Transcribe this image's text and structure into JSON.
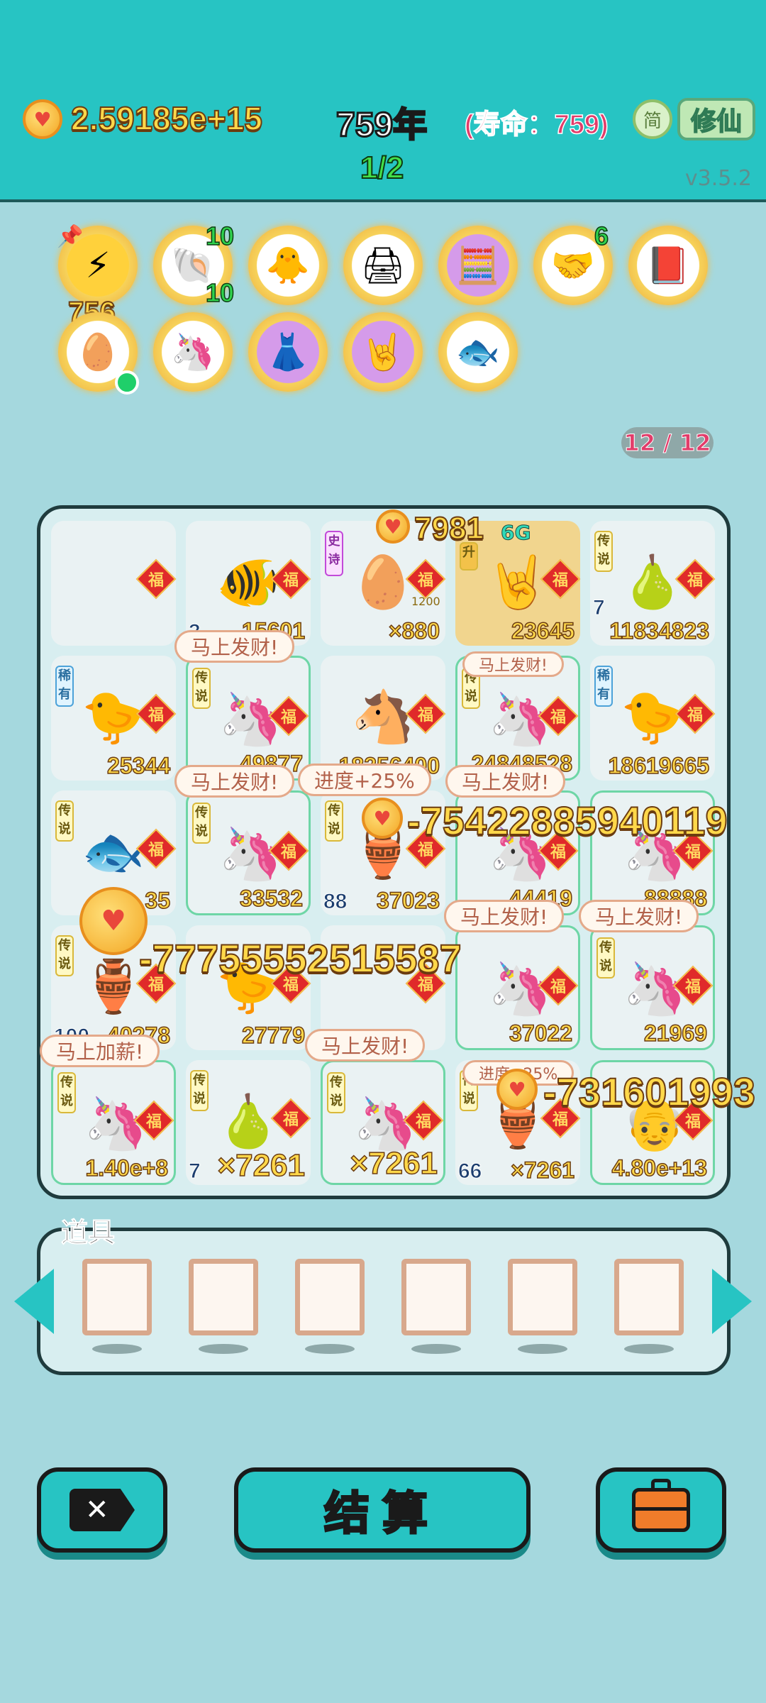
{
  "header": {
    "coins": "2.59185e+15",
    "year": "759年",
    "lifespan": "(寿命：759)",
    "jian_label": "简",
    "xiuxian_label": "修仙",
    "page": "1/2",
    "version": "v3.5.2"
  },
  "buffs": {
    "energy_count": "756",
    "shell_top": "10",
    "shell_bottom": "10",
    "handshake": "6"
  },
  "slot_count": "12 / 12",
  "board": {
    "cells": [
      {
        "num": "",
        "lv": ""
      },
      {
        "num": "15601",
        "lv": "3"
      },
      {
        "num": "×880",
        "lv": "",
        "tag": "史诗",
        "small": "1200"
      },
      {
        "num": "23645",
        "lv": "",
        "tag": "升"
      },
      {
        "num": "11834823",
        "lv": "7",
        "tag": "传说"
      },
      {
        "num": "25344",
        "lv": "",
        "tag": "稀有"
      },
      {
        "num": "49877",
        "lv": "",
        "tag": "传说"
      },
      {
        "num": "18256400",
        "lv": ""
      },
      {
        "num": "24848528",
        "lv": "",
        "tag": "传说"
      },
      {
        "num": "18619665",
        "lv": "",
        "tag": "稀有"
      },
      {
        "num": "35",
        "lv": "",
        "tag": "传说"
      },
      {
        "num": "33532",
        "lv": "",
        "tag": "传说"
      },
      {
        "num": "37023",
        "lv": "88",
        "tag": "传说"
      },
      {
        "num": "44419",
        "lv": ""
      },
      {
        "num": "88888",
        "lv": ""
      },
      {
        "num": "40278",
        "lv": "100",
        "tag": "传说"
      },
      {
        "num": "27779",
        "lv": ""
      },
      {
        "num": "",
        "lv": ""
      },
      {
        "num": "37022",
        "lv": ""
      },
      {
        "num": "21969",
        "lv": "",
        "tag": "传说"
      },
      {
        "num": "1.40e+8",
        "lv": "",
        "tag": "传说"
      },
      {
        "num": "×7261",
        "lv": "7",
        "tag": "传说"
      },
      {
        "num": "×7261",
        "lv": "",
        "tag": "传说"
      },
      {
        "num": "×7261",
        "lv": "66",
        "tag": "传说"
      },
      {
        "num": "4.80e+13",
        "lv": ""
      }
    ],
    "fu_label": "福",
    "bubbles": {
      "b1": "马上发财!",
      "b2": "马上发财!",
      "b3": "马上发财!",
      "b4": "进度+25%",
      "b5": "马上发财!",
      "b6": "马上发财!",
      "b7": "马上发财!",
      "b8": "马上加薪!",
      "b9": "马上发财!",
      "b10": "进度+25%"
    },
    "floats": {
      "f1": "7981",
      "f1b": "6G",
      "f2": "-75422885940119",
      "f3": "-77755552515587",
      "f4": "-731601993"
    }
  },
  "tools": {
    "title": "道具"
  },
  "bottom": {
    "settle_label": "结算"
  }
}
